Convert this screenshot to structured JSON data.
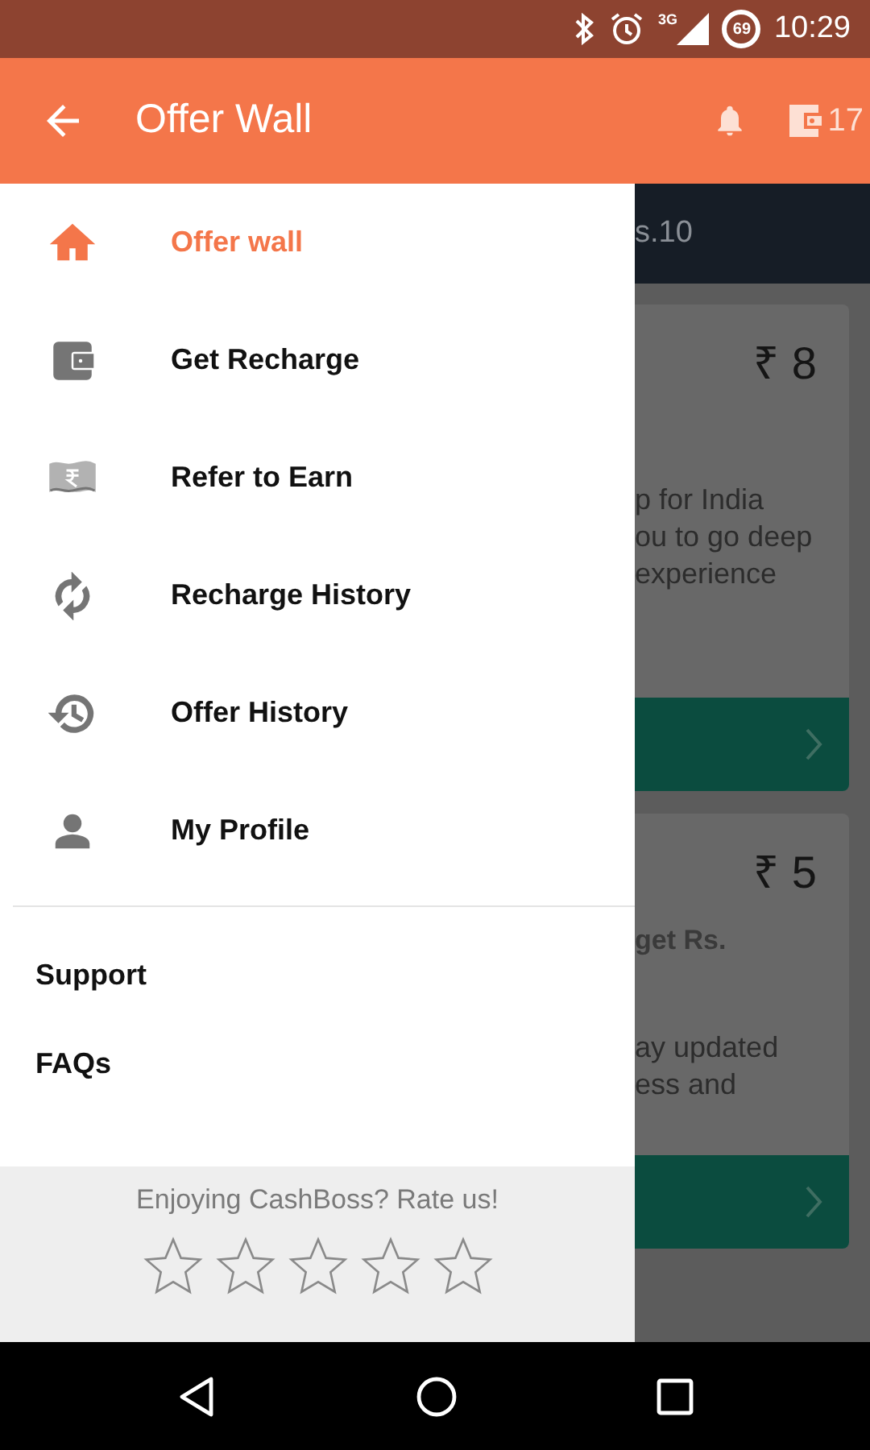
{
  "status_bar": {
    "network": "3G",
    "battery": "69",
    "time": "10:29"
  },
  "app_bar": {
    "title": "Offer Wall",
    "wallet_count": "17"
  },
  "drawer": {
    "items": [
      {
        "label": "Offer wall",
        "selected": true
      },
      {
        "label": "Get Recharge",
        "selected": false
      },
      {
        "label": "Refer to Earn",
        "selected": false
      },
      {
        "label": "Recharge History",
        "selected": false
      },
      {
        "label": "Offer History",
        "selected": false
      },
      {
        "label": "My Profile",
        "selected": false
      }
    ],
    "links": [
      "Support",
      "FAQs"
    ],
    "rating": {
      "prompt": "Enjoying CashBoss? Rate us!",
      "stars": 0
    }
  },
  "background": {
    "banner": "s.10",
    "offers": [
      {
        "price": "₹ 8",
        "lines": [
          "p for India",
          "ou to go deep",
          "experience"
        ]
      },
      {
        "price": "₹ 5",
        "heading": "get Rs.",
        "lines": [
          "ay updated",
          "ess and"
        ]
      }
    ]
  }
}
